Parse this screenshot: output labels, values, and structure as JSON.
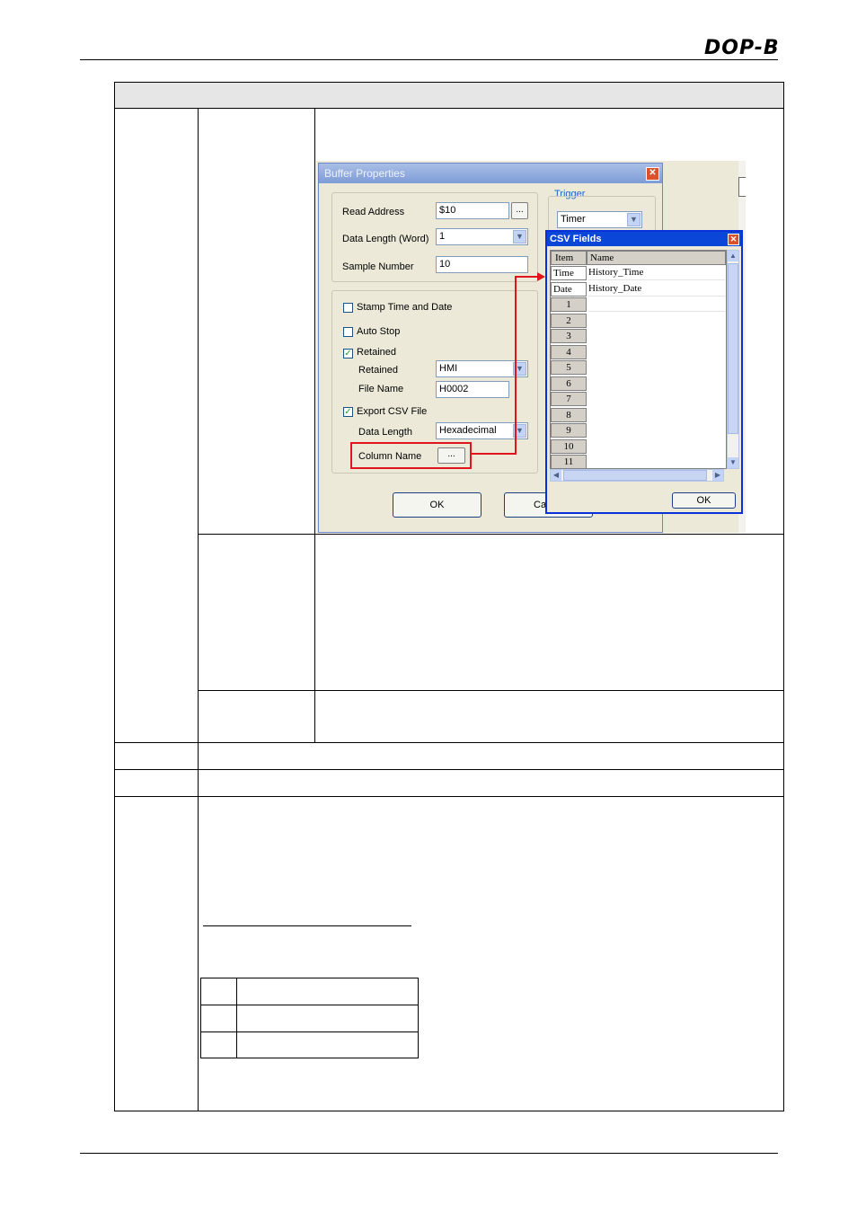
{
  "header": {
    "logo_text": "DOP-B"
  },
  "dialog": {
    "title": "Buffer Properties",
    "read_address_label": "Read Address",
    "read_address_value": "$10",
    "browse_label": "...",
    "data_length_label": "Data Length (Word)",
    "data_length_value": "1",
    "sample_number_label": "Sample Number",
    "sample_number_value": "10",
    "trigger_label": "Trigger",
    "trigger_value": "Timer",
    "stamp_label": "Stamp Time and Date",
    "stamp_checked": false,
    "autostop_label": "Auto Stop",
    "autostop_checked": false,
    "retained_label": "Retained",
    "retained_checked": true,
    "retained_field_label": "Retained",
    "retained_value": "HMI",
    "filename_label": "File Name",
    "filename_value": "H0002",
    "export_label": "Export CSV File",
    "export_checked": true,
    "export_data_length_label": "Data Length",
    "export_data_length_value": "Hexadecimal",
    "column_name_label": "Column Name",
    "column_name_button": "...",
    "ok_label": "OK",
    "cancel_label": "Ca"
  },
  "csv": {
    "title": "CSV Fields",
    "col_item": "Item",
    "col_name": "Name",
    "rows": [
      {
        "item": "Time",
        "name": "History_Time"
      },
      {
        "item": "Date",
        "name": "History_Date"
      },
      {
        "item": "1",
        "name": ""
      },
      {
        "item": "2",
        "name": ""
      },
      {
        "item": "3",
        "name": ""
      },
      {
        "item": "4",
        "name": ""
      },
      {
        "item": "5",
        "name": ""
      },
      {
        "item": "6",
        "name": ""
      },
      {
        "item": "7",
        "name": ""
      },
      {
        "item": "8",
        "name": ""
      },
      {
        "item": "9",
        "name": ""
      },
      {
        "item": "10",
        "name": ""
      },
      {
        "item": "11",
        "name": ""
      }
    ],
    "ok_label": "OK"
  },
  "colors": {
    "highlight": "#e0141c",
    "title_blue": "#0a46d8",
    "window_bg": "#ece9d8"
  }
}
